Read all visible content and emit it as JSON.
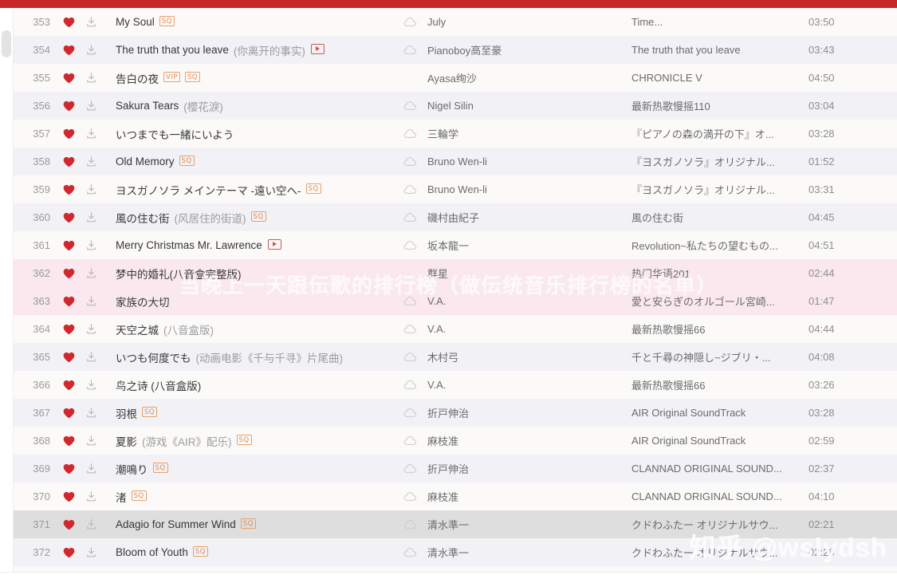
{
  "colors": {
    "top_bar": "#c62828",
    "row_odd": "#fbfaf9",
    "row_even": "#f2f1f6",
    "row_highlight": "#fae8ee",
    "row_selected": "#dedede",
    "badge_orange": "#e28b4e",
    "heart_red": "#d0282d"
  },
  "icons": {
    "heart": "heart-icon",
    "download": "download-icon",
    "cloud": "cloud-icon",
    "mv": "mv-play-icon",
    "scrollbar": "scrollbar-thumb"
  },
  "watermarks": {
    "band": "当晚上一天跟伝歌的排行榜（做伝统音乐排行榜的名单）",
    "corner": "知乎 @wslydsh"
  },
  "playlist": {
    "rows": [
      {
        "index": "353",
        "title": "My Soul",
        "alt": "",
        "badges": [
          "SQ"
        ],
        "mv": false,
        "cloud": true,
        "artist": "July",
        "album": "Time...",
        "time": "03:50",
        "state": "odd"
      },
      {
        "index": "354",
        "title": "The truth that you leave",
        "alt": "(你离开的事实)",
        "badges": [],
        "mv": true,
        "cloud": true,
        "artist": "Pianoboy高至豪",
        "album": "The truth that you leave",
        "time": "03:43",
        "state": "even"
      },
      {
        "index": "355",
        "title": "告白の夜",
        "alt": "",
        "badges": [
          "VIP",
          "SQ"
        ],
        "mv": false,
        "cloud": false,
        "artist": "Ayasa绚沙",
        "album": "CHRONICLE V",
        "time": "04:50",
        "state": "odd"
      },
      {
        "index": "356",
        "title": "Sakura Tears",
        "alt": "(櫻花淚)",
        "badges": [],
        "mv": false,
        "cloud": true,
        "artist": "Nigel Silin",
        "album": "最新热歌慢摇110",
        "time": "03:04",
        "state": "even"
      },
      {
        "index": "357",
        "title": "いつまでも一緒にいよう",
        "alt": "",
        "badges": [],
        "mv": false,
        "cloud": true,
        "artist": "三輪学",
        "album": "『ピアノの森の満开の下』オ...",
        "time": "03:28",
        "state": "odd"
      },
      {
        "index": "358",
        "title": "Old Memory",
        "alt": "",
        "badges": [
          "SQ"
        ],
        "mv": false,
        "cloud": true,
        "artist": "Bruno Wen-li",
        "album": "『ヨスガノソラ』オリジナル...",
        "time": "01:52",
        "state": "even"
      },
      {
        "index": "359",
        "title": "ヨスガノソラ メインテーマ -遠い空へ-",
        "alt": "",
        "badges": [
          "SQ"
        ],
        "mv": false,
        "cloud": true,
        "artist": "Bruno Wen-li",
        "album": "『ヨスガノソラ』オリジナル...",
        "time": "03:31",
        "state": "odd"
      },
      {
        "index": "360",
        "title": "風の住む街",
        "alt": "(风居住的街道)",
        "badges": [
          "SQ"
        ],
        "mv": false,
        "cloud": true,
        "artist": "磯村由紀子",
        "album": "風の住む街",
        "time": "04:45",
        "state": "even"
      },
      {
        "index": "361",
        "title": "Merry Christmas Mr. Lawrence",
        "alt": "",
        "badges": [],
        "mv": true,
        "cloud": true,
        "artist": "坂本龍一",
        "album": "Revolution~私たちの望むもの...",
        "time": "04:51",
        "state": "odd"
      },
      {
        "index": "362",
        "title": "梦中的婚礼(八音盒完整版)",
        "alt": "",
        "badges": [],
        "mv": false,
        "cloud": false,
        "artist": "群星",
        "album": "热门华语201",
        "time": "02:44",
        "state": "hl"
      },
      {
        "index": "363",
        "title": "家族の大切",
        "alt": "",
        "badges": [],
        "mv": false,
        "cloud": true,
        "artist": "V.A.",
        "album": "愛と安らぎのオルゴール宮崎...",
        "time": "01:47",
        "state": "hl"
      },
      {
        "index": "364",
        "title": "天空之城",
        "alt": "(八音盒版)",
        "badges": [],
        "mv": false,
        "cloud": true,
        "artist": "V.A.",
        "album": "最新热歌慢摇66",
        "time": "04:44",
        "state": "odd"
      },
      {
        "index": "365",
        "title": "いつも何度でも",
        "alt": "(动画电影《千与千寻》片尾曲)",
        "badges": [],
        "mv": false,
        "cloud": true,
        "artist": "木村弓",
        "album": "千と千尋の神隠し~ジブリ・...",
        "time": "04:08",
        "state": "even"
      },
      {
        "index": "366",
        "title": "鸟之诗 (八音盒版)",
        "alt": "",
        "badges": [],
        "mv": false,
        "cloud": true,
        "artist": "V.A.",
        "album": "最新热歌慢摇66",
        "time": "03:26",
        "state": "odd"
      },
      {
        "index": "367",
        "title": "羽根",
        "alt": "",
        "badges": [
          "SQ"
        ],
        "mv": false,
        "cloud": true,
        "artist": "折戸伸治",
        "album": "AIR Original SoundTrack",
        "time": "03:28",
        "state": "even"
      },
      {
        "index": "368",
        "title": "夏影",
        "alt": "(游戏《AIR》配乐)",
        "badges": [
          "SQ"
        ],
        "mv": false,
        "cloud": true,
        "artist": "麻枝准",
        "album": "AIR Original SoundTrack",
        "time": "02:59",
        "state": "odd"
      },
      {
        "index": "369",
        "title": "潮鳴り",
        "alt": "",
        "badges": [
          "SQ"
        ],
        "mv": false,
        "cloud": true,
        "artist": "折戸伸治",
        "album": "CLANNAD ORIGINAL SOUND...",
        "time": "02:37",
        "state": "even"
      },
      {
        "index": "370",
        "title": "渚",
        "alt": "",
        "badges": [
          "SQ"
        ],
        "mv": false,
        "cloud": true,
        "artist": "麻枝准",
        "album": "CLANNAD ORIGINAL SOUND...",
        "time": "04:10",
        "state": "odd"
      },
      {
        "index": "371",
        "title": "Adagio for Summer Wind",
        "alt": "",
        "badges": [
          "SQ"
        ],
        "mv": false,
        "cloud": true,
        "artist": "清水準一",
        "album": "クドわふたー オリジナルサウ...",
        "time": "02:21",
        "state": "sel"
      },
      {
        "index": "372",
        "title": "Bloom of Youth",
        "alt": "",
        "badges": [
          "SQ"
        ],
        "mv": false,
        "cloud": true,
        "artist": "清水準一",
        "album": "クドわふたー オリジナルサウ...",
        "time": "02:28",
        "state": "even"
      }
    ]
  }
}
